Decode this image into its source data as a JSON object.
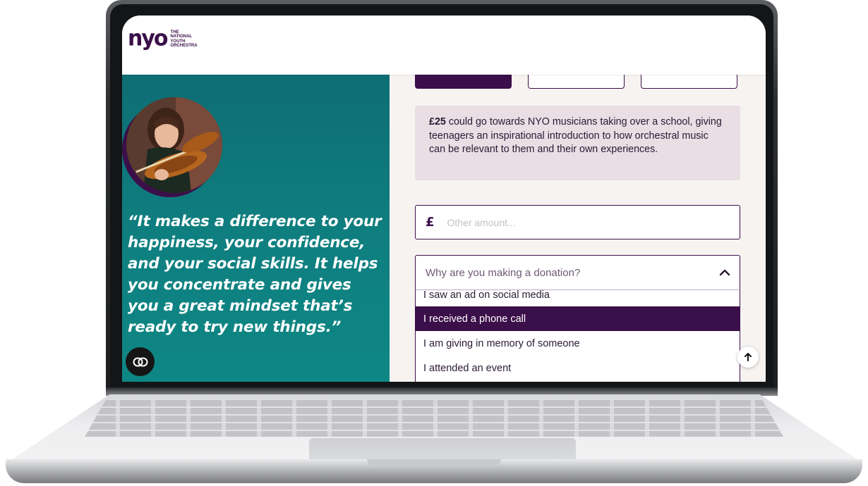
{
  "header": {
    "logo_mark": "nyo",
    "logo_lines": [
      "THE",
      "NATIONAL",
      "YOUTH",
      "ORCHESTRA"
    ]
  },
  "left_panel": {
    "photo_alt": "Smiling young violinist playing in an orchestra",
    "quote": "“It makes a difference to your happiness, your confidence, and your social skills. It helps you concentrate and gives you a great mindset that’s ready to try new things.”"
  },
  "donation_form": {
    "amount_options_visible": 3,
    "selected_amount_index": 0,
    "info": {
      "amount": "£25",
      "text": " could go towards NYO musicians taking over a school, giving teenagers an inspirational introduction to how orchestral music can be relevant to them and their own experiences."
    },
    "other_amount": {
      "currency": "£",
      "placeholder": "Other amount...",
      "value": ""
    },
    "reason_select": {
      "placeholder": "Why are you making a donation?",
      "expanded": true,
      "options": [
        "I saw an ad on social media",
        "I received a phone call",
        "I am giving in memory of someone",
        "I attended an event"
      ],
      "highlighted_index": 1
    }
  },
  "floating": {
    "chat_icon": "chat-bubbles-icon",
    "scroll_top_icon": "arrow-up-icon"
  },
  "colors": {
    "brand_purple": "#3b0f49",
    "teal_panel": "#0f7f80",
    "info_box_bg": "#e8dee4"
  }
}
